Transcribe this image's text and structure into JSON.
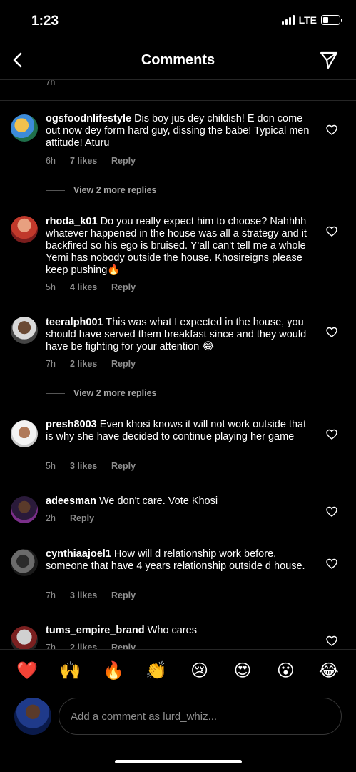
{
  "status_bar": {
    "time": "1:23",
    "network": "LTE",
    "battery_level": 0.35
  },
  "header": {
    "title": "Comments",
    "back_icon": "chevron-left-icon",
    "share_icon": "paper-plane-icon"
  },
  "partial_comment": {
    "time": "7h"
  },
  "comments": [
    {
      "username": "ogsfoodnlifestyle",
      "text": "Dis boy jus dey childish! E don come out now dey form hard guy, dissing the babe! Typical men attitude! Aturu",
      "time": "6h",
      "likes": "7 likes",
      "reply": "Reply",
      "view_replies": "View 2 more replies"
    },
    {
      "username": "rhoda_k01",
      "text": "Do you really expect him to choose? Nahhhh whatever happened in the house was all a strategy and it backfired so his ego is bruised. Y'all can't tell me a whole Yemi has nobody outside the house. Khosireigns please keep pushing🔥",
      "time": "5h",
      "likes": "4 likes",
      "reply": "Reply"
    },
    {
      "username": "teeralph001",
      "text": "This was what I expected in the house, you should have served them breakfast since and they would have be fighting for your attention 😂",
      "time": "7h",
      "likes": "2 likes",
      "reply": "Reply",
      "view_replies": "View 2 more replies"
    },
    {
      "username": "presh8003",
      "text": "Even khosi knows it will not work outside that is why she have decided to continue playing her game",
      "time": "5h",
      "likes": "3 likes",
      "reply": "Reply"
    },
    {
      "username": "adeesman",
      "text": "We don't care. Vote Khosi",
      "time": "2h",
      "reply": "Reply"
    },
    {
      "username": "cynthiaajoel1",
      "text": "How will d relationship work before, someone that have 4 years relationship outside d house.",
      "time": "7h",
      "likes": "3 likes",
      "reply": "Reply"
    },
    {
      "username": "tums_empire_brand",
      "text": "Who cares",
      "time": "7h",
      "likes": "2 likes",
      "reply": "Reply"
    }
  ],
  "reactions": [
    "❤️",
    "🙌",
    "🔥",
    "👏",
    "😢",
    "😍",
    "😮",
    "😂"
  ],
  "comment_input": {
    "placeholder": "Add a comment as lurd_whiz..."
  },
  "colors": {
    "background": "#000000",
    "secondary_text": "#8e8e8e",
    "divider": "#262626"
  }
}
